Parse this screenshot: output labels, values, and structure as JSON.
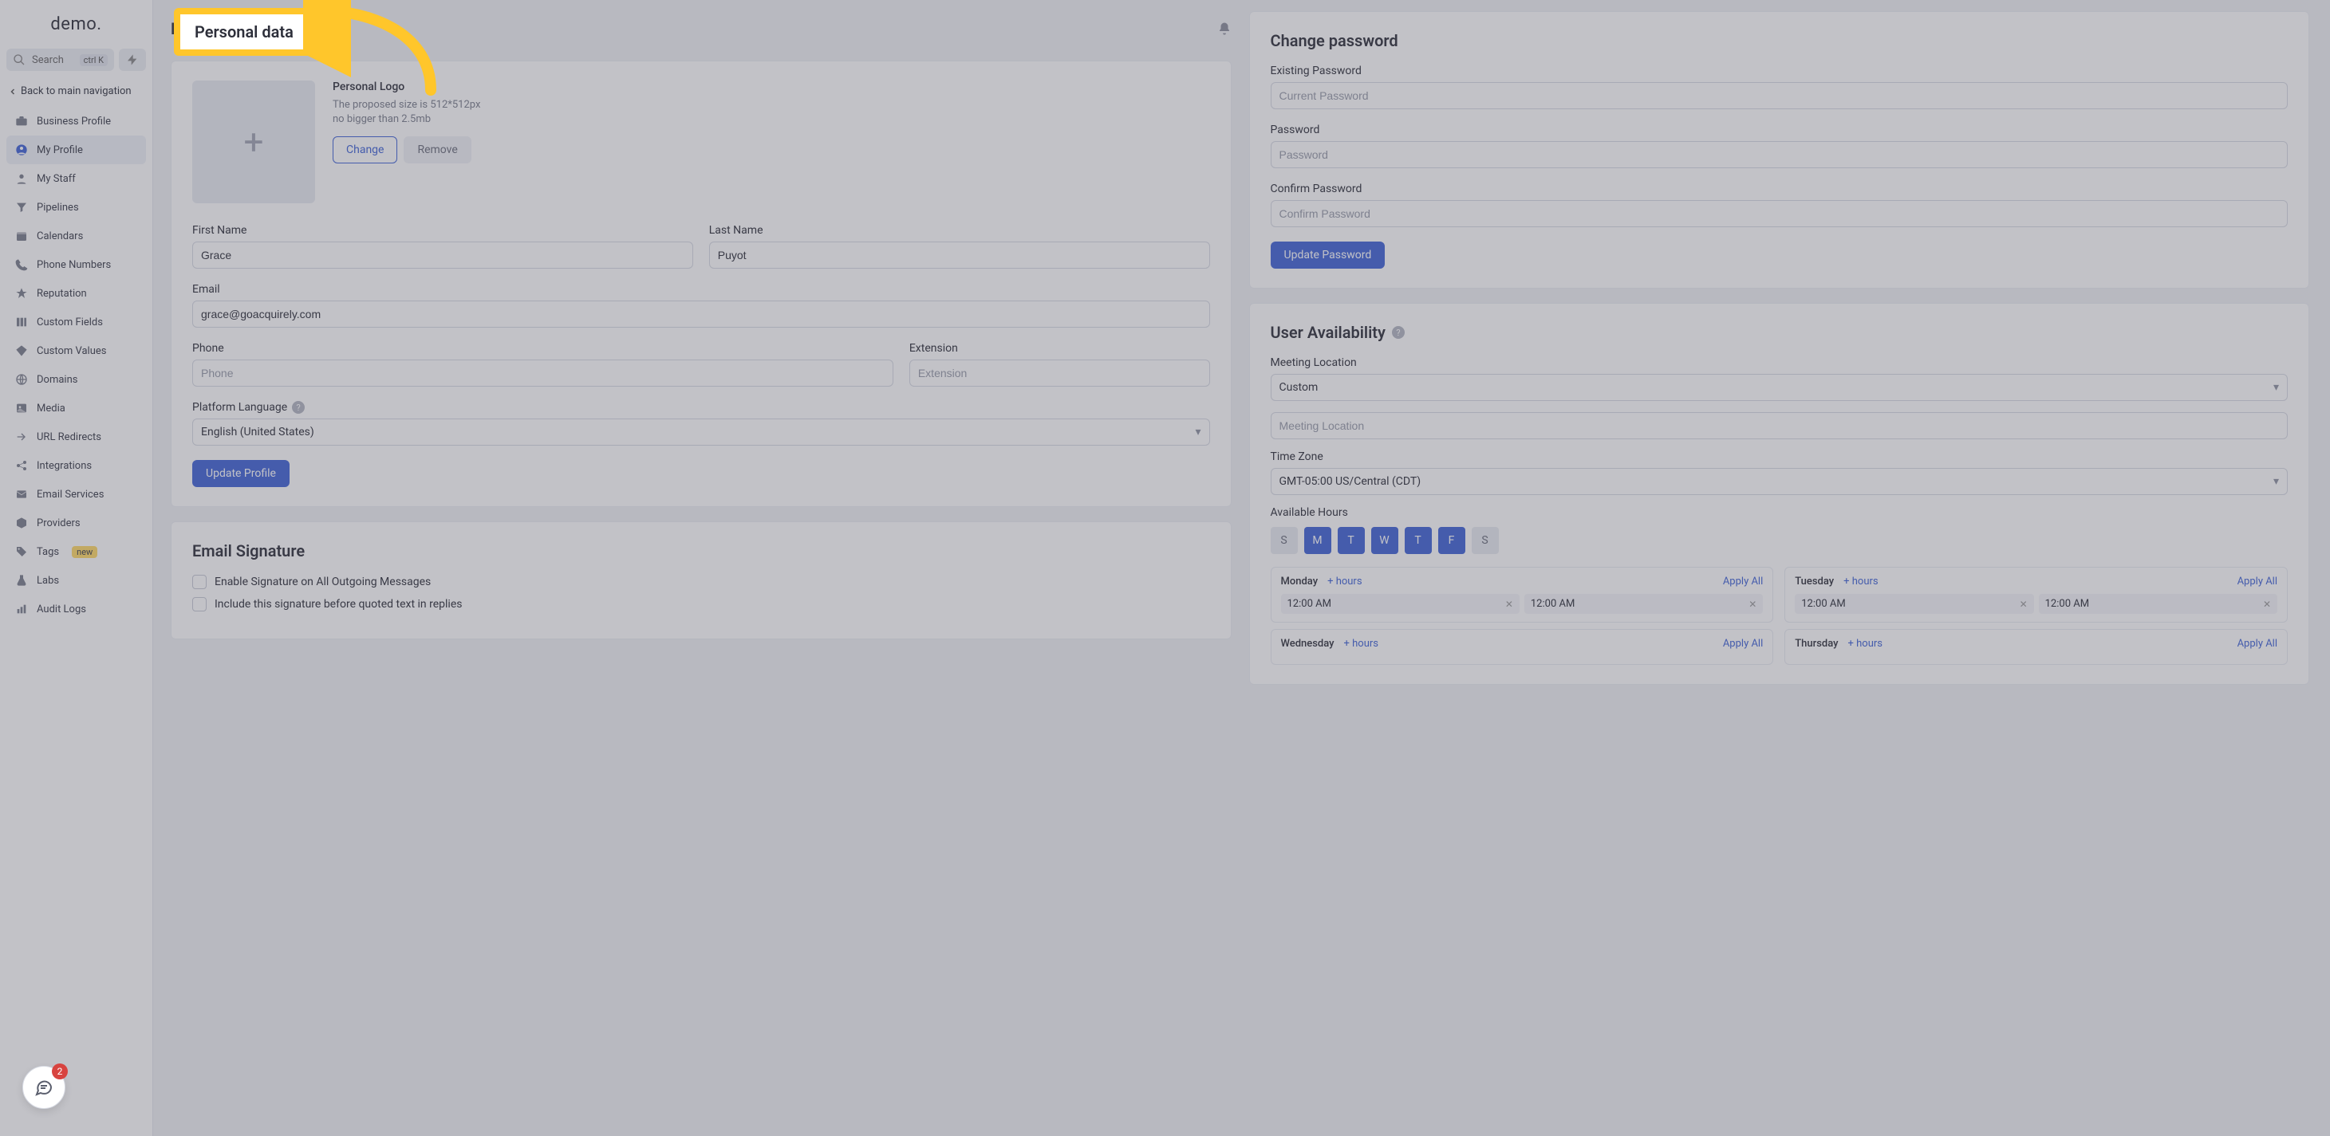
{
  "brand": "demo.",
  "search": {
    "label": "Search",
    "kbd": "ctrl K"
  },
  "back_nav": "Back to main navigation",
  "nav": [
    {
      "label": "Business Profile",
      "icon": "briefcase"
    },
    {
      "label": "My Profile",
      "icon": "user-circle",
      "active": true
    },
    {
      "label": "My Staff",
      "icon": "user"
    },
    {
      "label": "Pipelines",
      "icon": "filter"
    },
    {
      "label": "Calendars",
      "icon": "calendar"
    },
    {
      "label": "Phone Numbers",
      "icon": "phone"
    },
    {
      "label": "Reputation",
      "icon": "star"
    },
    {
      "label": "Custom Fields",
      "icon": "columns"
    },
    {
      "label": "Custom Values",
      "icon": "diamond"
    },
    {
      "label": "Domains",
      "icon": "globe"
    },
    {
      "label": "Media",
      "icon": "image"
    },
    {
      "label": "URL Redirects",
      "icon": "redirect"
    },
    {
      "label": "Integrations",
      "icon": "share"
    },
    {
      "label": "Email Services",
      "icon": "mail"
    },
    {
      "label": "Providers",
      "icon": "box"
    },
    {
      "label": "Tags",
      "icon": "tag",
      "badge": "new"
    },
    {
      "label": "Labs",
      "icon": "flask"
    },
    {
      "label": "Audit Logs",
      "icon": "bars"
    }
  ],
  "chat_badge": "2",
  "page_title": "Personal data",
  "logo_section": {
    "title": "Personal Logo",
    "hint1": "The proposed size is 512*512px",
    "hint2": "no bigger than 2.5mb",
    "change": "Change",
    "remove": "Remove"
  },
  "fields": {
    "first_name_label": "First Name",
    "first_name": "Grace",
    "last_name_label": "Last Name",
    "last_name": "Puyot",
    "email_label": "Email",
    "email": "grace@goacquirely.com",
    "phone_label": "Phone",
    "phone_ph": "Phone",
    "ext_label": "Extension",
    "ext_ph": "Extension",
    "lang_label": "Platform Language",
    "lang_value": "English (United States)",
    "update_profile": "Update Profile"
  },
  "sig": {
    "title": "Email Signature",
    "opt1": "Enable Signature on All Outgoing Messages",
    "opt2": "Include this signature before quoted text in replies"
  },
  "pwd": {
    "title": "Change password",
    "existing_label": "Existing Password",
    "existing_ph": "Current Password",
    "new_label": "Password",
    "new_ph": "Password",
    "confirm_label": "Confirm Password",
    "confirm_ph": "Confirm Password",
    "button": "Update Password"
  },
  "avail": {
    "title": "User Availability",
    "meeting_loc_label": "Meeting Location",
    "meeting_loc_value": "Custom",
    "meeting_loc_ph": "Meeting Location",
    "tz_label": "Time Zone",
    "tz_value": "GMT-05:00 US/Central (CDT)",
    "hours_label": "Available Hours",
    "days": [
      {
        "letter": "S",
        "on": false
      },
      {
        "letter": "M",
        "on": true
      },
      {
        "letter": "T",
        "on": true
      },
      {
        "letter": "W",
        "on": true
      },
      {
        "letter": "T",
        "on": true
      },
      {
        "letter": "F",
        "on": true
      },
      {
        "letter": "S",
        "on": false
      }
    ],
    "add_hours": "+ hours",
    "apply_all": "Apply All",
    "schedule": [
      {
        "day": "Monday",
        "from": "12:00 AM",
        "to": "12:00 AM"
      },
      {
        "day": "Tuesday",
        "from": "12:00 AM",
        "to": "12:00 AM"
      },
      {
        "day": "Wednesday",
        "from": "",
        "to": ""
      },
      {
        "day": "Thursday",
        "from": "",
        "to": ""
      }
    ]
  }
}
